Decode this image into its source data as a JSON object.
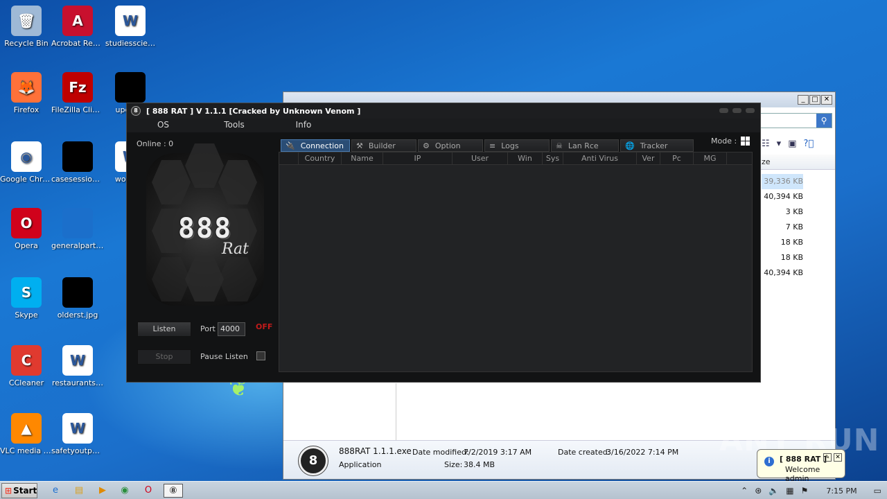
{
  "desktop": {
    "icons": [
      {
        "label": "Recycle Bin",
        "icon": "recycle-bin-icon",
        "color": "#9fb9d6",
        "glyph": "🗑"
      },
      {
        "label": "Acrobat Reader DC",
        "icon": "acrobat-icon",
        "color": "#c8102e",
        "glyph": "A"
      },
      {
        "label": "studiesscie…",
        "icon": "word-doc-icon",
        "color": "#ffffff",
        "glyph": "W"
      },
      {
        "label": "Firefox",
        "icon": "firefox-icon",
        "color": "#ff7139",
        "glyph": "🦊"
      },
      {
        "label": "FileZilla Client",
        "icon": "filezilla-icon",
        "color": "#bf0000",
        "glyph": "Fz"
      },
      {
        "label": "updat…",
        "icon": "redacted-file-icon",
        "color": "#000000",
        "glyph": ""
      },
      {
        "label": "Google Chrome",
        "icon": "chrome-icon",
        "color": "#ffffff",
        "glyph": "◉"
      },
      {
        "label": "casesession…",
        "icon": "redacted-file-icon",
        "color": "#000000",
        "glyph": ""
      },
      {
        "label": "woma…",
        "icon": "word-doc-icon",
        "color": "#ffffff",
        "glyph": "W"
      },
      {
        "label": "Opera",
        "icon": "opera-icon",
        "color": "#d0021b",
        "glyph": "O"
      },
      {
        "label": "generalparti…",
        "icon": "blank-file-icon",
        "color": "#1b6fcb",
        "glyph": ""
      },
      {
        "label": "Skype",
        "icon": "skype-icon",
        "color": "#00aff0",
        "glyph": "S"
      },
      {
        "label": "olderst.jpg",
        "icon": "redacted-file-icon",
        "color": "#000000",
        "glyph": ""
      },
      {
        "label": "CCleaner",
        "icon": "ccleaner-icon",
        "color": "#e03a2f",
        "glyph": "C"
      },
      {
        "label": "restaurants…",
        "icon": "word-doc-icon",
        "color": "#ffffff",
        "glyph": "W"
      },
      {
        "label": "VLC media player",
        "icon": "vlc-icon",
        "color": "#ff8800",
        "glyph": "▲"
      },
      {
        "label": "safetyoutpu…",
        "icon": "word-doc-icon",
        "color": "#ffffff",
        "glyph": "W"
      }
    ]
  },
  "explorer": {
    "col_header": "ze",
    "sizes": [
      "39,336 KB",
      "40,394 KB",
      "3 KB",
      "7 KB",
      "18 KB",
      "18 KB",
      "40,394 KB"
    ],
    "details": {
      "name": "888RAT 1.1.1.exe",
      "type": "Application",
      "modified_label": "Date modified:",
      "modified": "7/2/2019 3:17 AM",
      "size_label": "Size:",
      "size": "38.4 MB",
      "created_label": "Date created:",
      "created": "3/16/2022 7:14 PM"
    }
  },
  "rat": {
    "title": "[  888 RAT  ] V 1.1.1 [Cracked by Unknown Venom ]",
    "menu": [
      "OS",
      "Tools",
      "Info"
    ],
    "online": "Online : 0",
    "logo_big": "888",
    "logo_small": "Rat",
    "listen": "Listen",
    "stop": "Stop",
    "port_label": "Port",
    "port_value": "4000",
    "status": "OFF",
    "pause_label": "Pause Listen",
    "mode_label": "Mode :",
    "tabs": [
      {
        "label": "Connection",
        "icon": "plug-icon",
        "glyph": "🔌"
      },
      {
        "label": "Builder",
        "icon": "tools-icon",
        "glyph": "⚒"
      },
      {
        "label": "Option",
        "icon": "gear-icon",
        "glyph": "⚙"
      },
      {
        "label": "Logs",
        "icon": "database-icon",
        "glyph": "≡"
      },
      {
        "label": "Lan Rce",
        "icon": "skull-icon",
        "glyph": "☠"
      },
      {
        "label": "Tracker",
        "icon": "globe-icon",
        "glyph": "🌐"
      }
    ],
    "columns": [
      "Country",
      "Name",
      "IP",
      "User",
      "Win",
      "Sys",
      "Anti Virus",
      "Ver",
      "Pc",
      "MG"
    ]
  },
  "taskbar": {
    "start": "Start",
    "clock": "7:15 PM"
  },
  "balloon": {
    "title": "[ 888 RAT ]",
    "message": "Welcome admin"
  },
  "watermark": "ANY RUN"
}
